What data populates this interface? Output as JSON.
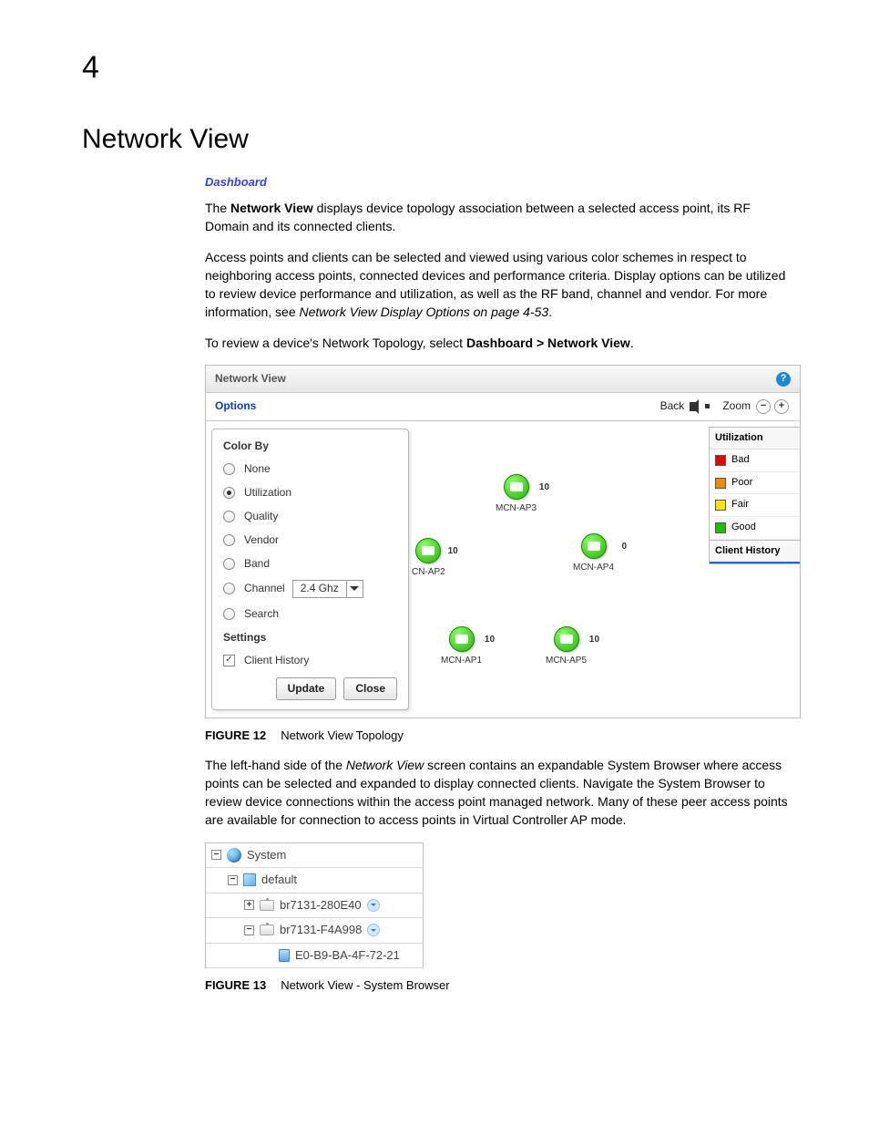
{
  "chapter_number": "4",
  "heading": "Network View",
  "breadcrumb_link": "Dashboard",
  "para1": {
    "pre": "The ",
    "bold": "Network View",
    "rest": " displays device topology association between a selected access point, its RF Domain and its connected clients."
  },
  "para2": {
    "body": "Access points and clients can be selected and viewed using various color schemes in respect to neighboring access points, connected devices and performance criteria. Display options can be utilized to review device performance and utilization, as well as the RF band, channel and vendor. For more information, see ",
    "ital": "Network View Display Options on page 4-53",
    "trail": "."
  },
  "para3": {
    "pre": "To review a device's Network Topology, select ",
    "bold": "Dashboard > Network View",
    "trail": "."
  },
  "panel": {
    "title": "Network View",
    "options_label": "Options",
    "back_label": "Back",
    "zoom_label": "Zoom",
    "colorby_heading": "Color By",
    "colorby": {
      "none": "None",
      "utilization": "Utilization",
      "quality": "Quality",
      "vendor": "Vendor",
      "band": "Band",
      "channel": "Channel",
      "search": "Search"
    },
    "channel_sel": "2.4 Ghz",
    "settings_heading": "Settings",
    "client_history": "Client History",
    "update_btn": "Update",
    "close_btn": "Close",
    "nodes": {
      "ap1": {
        "label": "MCN-AP1",
        "count": "10"
      },
      "ap2": {
        "label": "CN-AP2",
        "count": "10"
      },
      "ap3": {
        "label": "MCN-AP3",
        "count": "10"
      },
      "ap4": {
        "label": "MCN-AP4",
        "count": "0"
      },
      "ap5": {
        "label": "MCN-AP5",
        "count": "10"
      }
    },
    "legend": {
      "head": "Utilization",
      "bad": "Bad",
      "poor": "Poor",
      "fair": "Fair",
      "good": "Good",
      "client_history": "Client History"
    }
  },
  "fig12": {
    "num": "FIGURE 12",
    "cap": "Network View Topology"
  },
  "para4": {
    "pre": "The left-hand side of the ",
    "ital": "Network View",
    "rest": " screen contains an expandable System Browser where access points can be selected and expanded to display connected clients. Navigate the System Browser to review device connections within the access point managed network. Many of these peer access points are available for connection to access points in Virtual Controller AP mode."
  },
  "tree": {
    "system": "System",
    "default": "default",
    "ap_a": "br7131-280E40",
    "ap_b": "br7131-F4A998",
    "client": "E0-B9-BA-4F-72-21"
  },
  "fig13": {
    "num": "FIGURE 13",
    "cap": "Network View - System Browser"
  }
}
